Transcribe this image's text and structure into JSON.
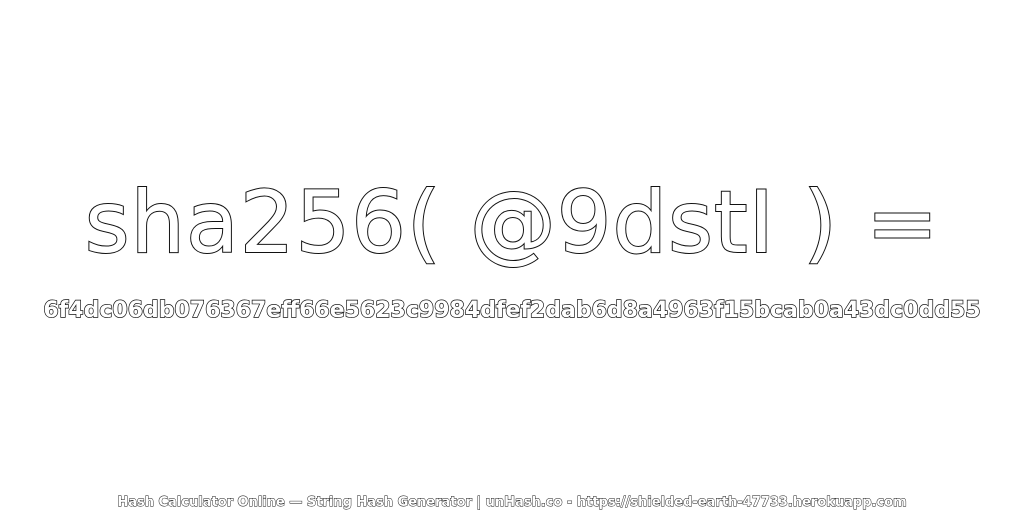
{
  "heading": "sha256( @9dstI ) =",
  "hash": "6f4dc06db076367eff66e5623c9984dfef2dab6d8a4963f15bcab0a43dc0dd55",
  "footer": "Hash Calculator Online — String Hash Generator | unHash.co - https://shielded-earth-47733.herokuapp.com",
  "colors": {
    "background": "#ffffff",
    "text_fill": "#ffffff",
    "text_outline": "#111111"
  }
}
